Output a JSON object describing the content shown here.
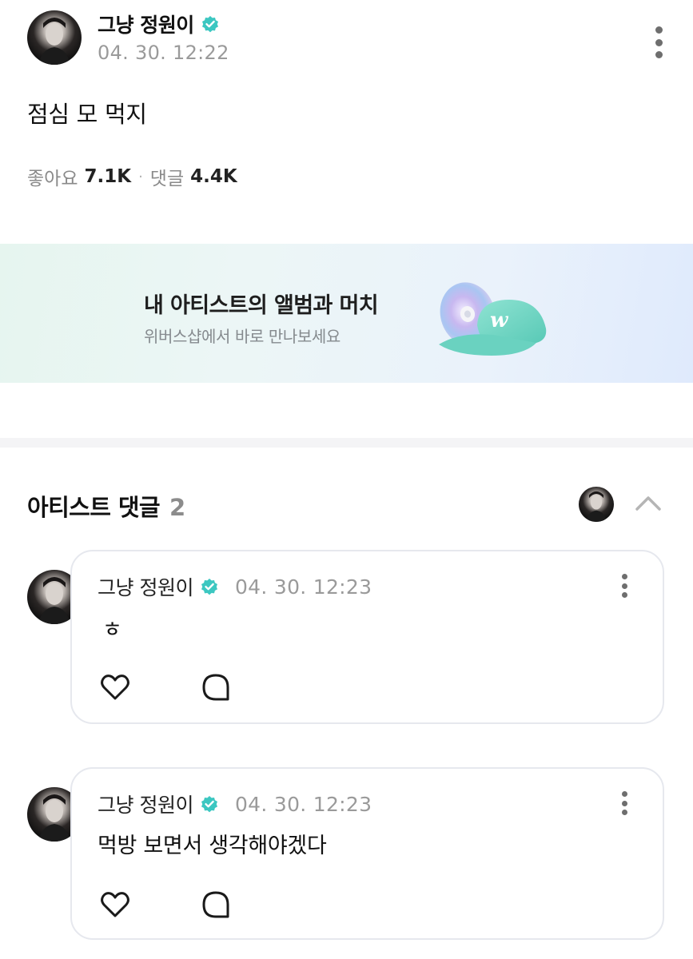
{
  "post": {
    "author": "그냥 정원이",
    "timestamp": "04. 30. 12:22",
    "body": "점심 모 먹지",
    "likes_label": "좋아요",
    "likes_count": "7.1K",
    "separator": "·",
    "comments_label": "댓글",
    "comments_count": "4.4K",
    "verified_icon": "verified-badge-icon",
    "more_icon": "more-vertical-icon"
  },
  "banner": {
    "title": "내 아티스트의 앨범과 머치",
    "subtitle": "위버스샵에서 바로 만나보세요",
    "cap_logo": "w"
  },
  "artist_comments": {
    "title": "아티스트 댓글",
    "count": "2",
    "collapse_icon": "chevron-up-icon",
    "items": [
      {
        "author": "그냥 정원이",
        "timestamp": "04. 30. 12:23",
        "text": "ㅎ"
      },
      {
        "author": "그냥 정원이",
        "timestamp": "04. 30. 12:23",
        "text": "먹방 보면서 생각해야겠다"
      }
    ]
  },
  "colors": {
    "verified": "#3cc7c1",
    "muted_text": "#9a9a9a",
    "card_border": "#e6e8ee",
    "divider": "#f4f4f6"
  }
}
